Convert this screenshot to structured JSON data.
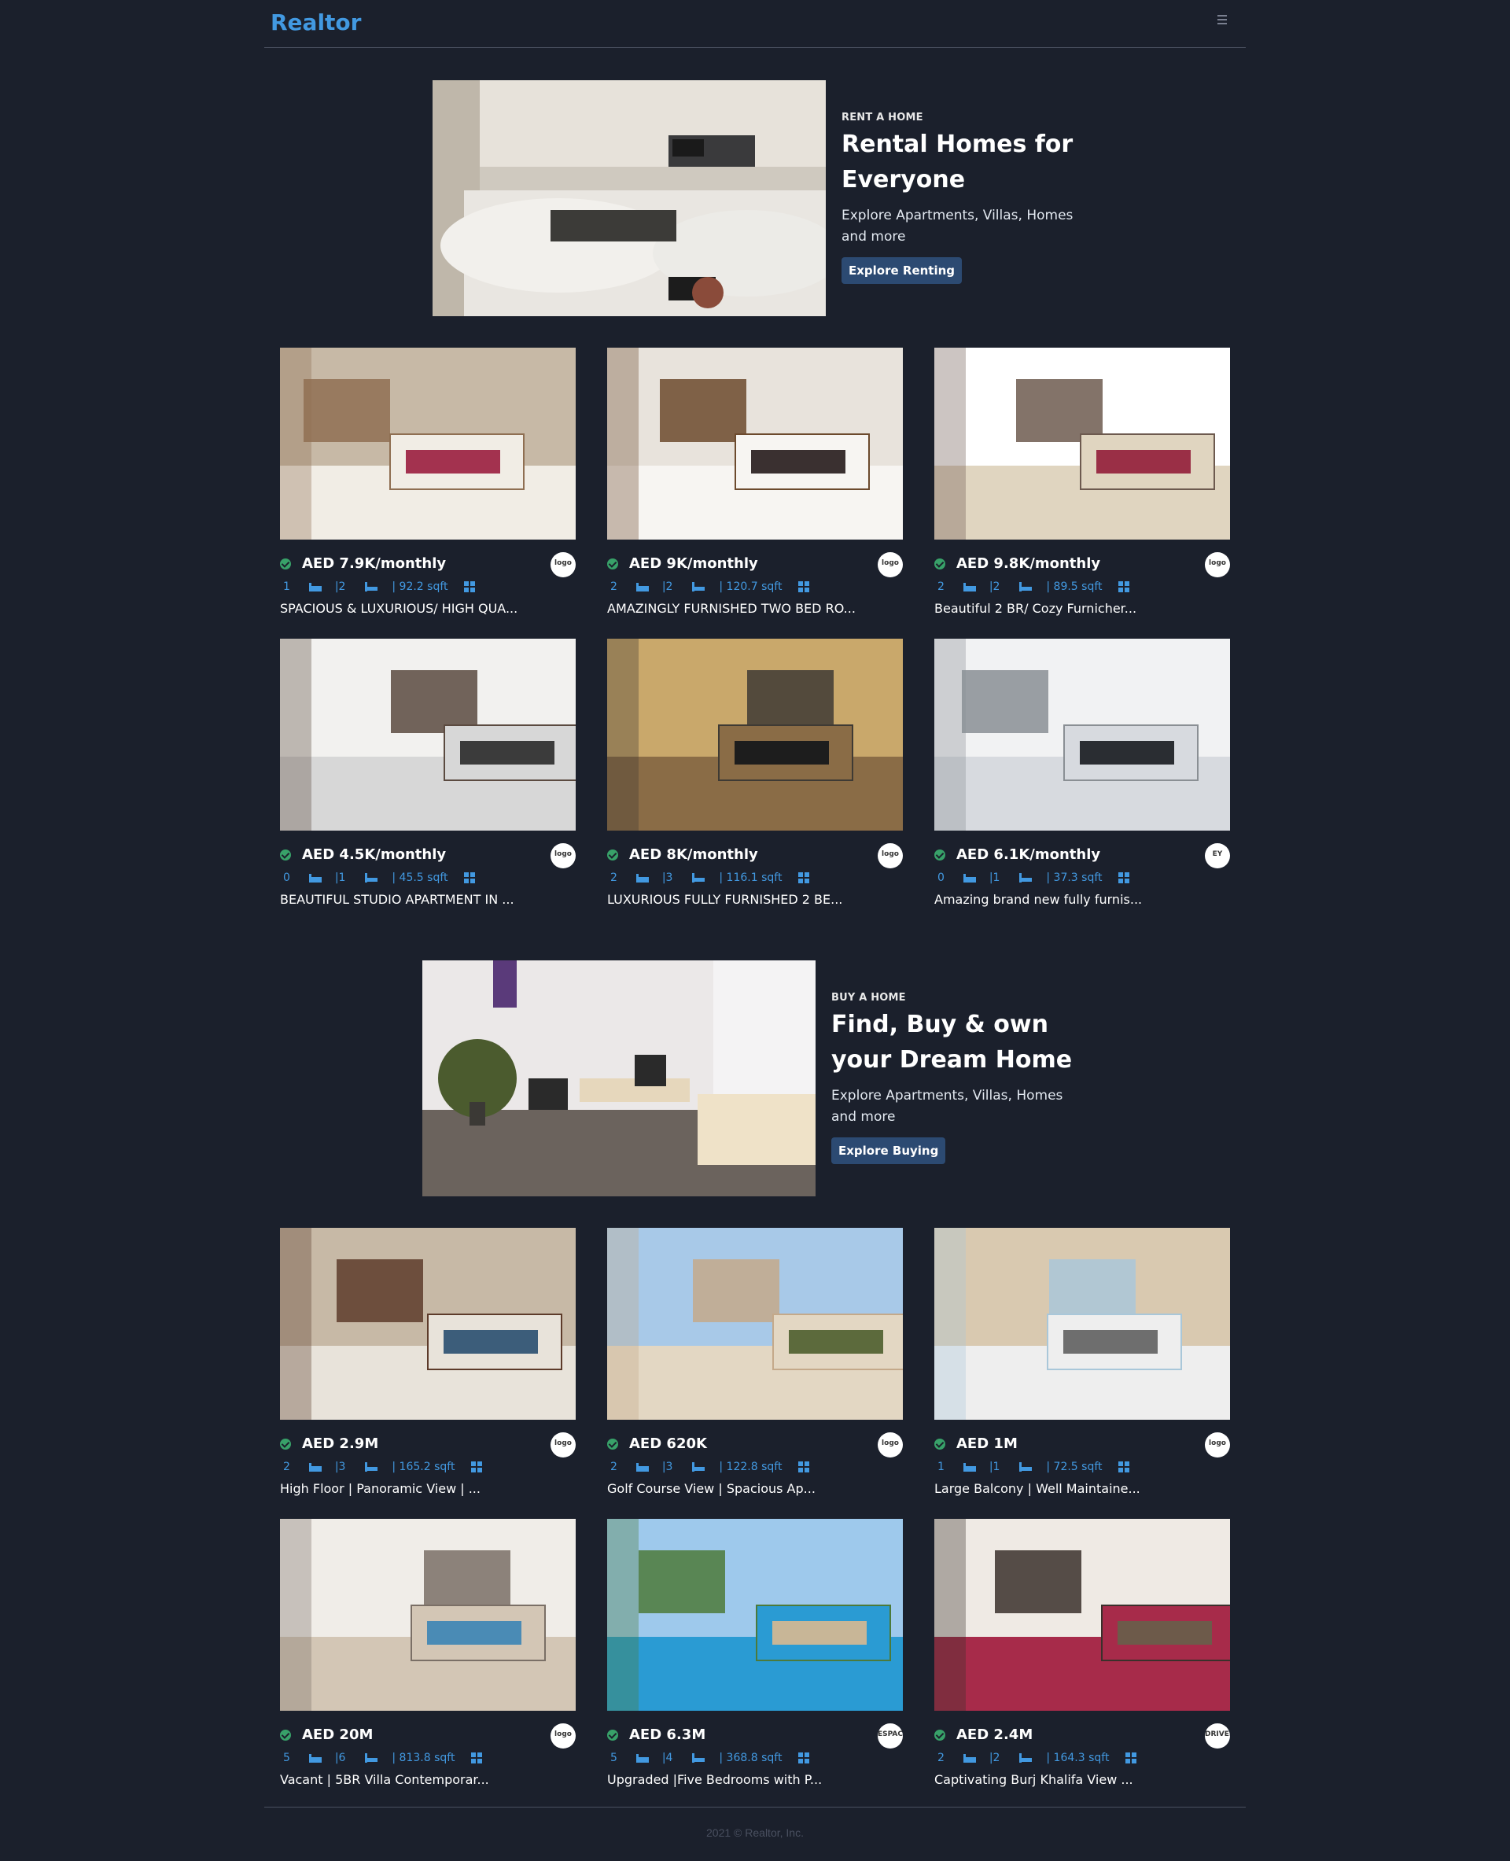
{
  "header": {
    "logo": "Realtor",
    "menu_icon": "hamburger-icon"
  },
  "rent_banner": {
    "purpose": "RENT A HOME",
    "title": "Rental Homes for Everyone",
    "description": "Explore Apartments, Villas, Homes and more",
    "button": "Explore Renting"
  },
  "rent_listings": [
    {
      "price": "AED 7.9K/monthly",
      "rooms": "1",
      "baths": "2",
      "area": "92.2 sqft",
      "title": "SPACIOUS & LUXURIOUS/ HIGH QUA...",
      "agency": "logo"
    },
    {
      "price": "AED 9K/monthly",
      "rooms": "2",
      "baths": "2",
      "area": "120.7 sqft",
      "title": "AMAZINGLY FURNISHED TWO BED RO...",
      "agency": "logo"
    },
    {
      "price": "AED 9.8K/monthly",
      "rooms": "2",
      "baths": "2",
      "area": "89.5 sqft",
      "title": "Beautiful 2 BR/ Cozy Furnicher...",
      "agency": "logo"
    },
    {
      "price": "AED 4.5K/monthly",
      "rooms": "0",
      "baths": "1",
      "area": "45.5 sqft",
      "title": "BEAUTIFUL STUDIO APARTMENT IN ...",
      "agency": "logo"
    },
    {
      "price": "AED 8K/monthly",
      "rooms": "2",
      "baths": "3",
      "area": "116.1 sqft",
      "title": "LUXURIOUS FULLY FURNISHED 2 BE...",
      "agency": "logo"
    },
    {
      "price": "AED 6.1K/monthly",
      "rooms": "0",
      "baths": "1",
      "area": "37.3 sqft",
      "title": "Amazing brand new fully furnis...",
      "agency": "EY"
    }
  ],
  "buy_banner": {
    "purpose": "BUY A HOME",
    "title": "Find, Buy & own your Dream Home",
    "description": "Explore Apartments, Villas, Homes and more",
    "button": "Explore Buying"
  },
  "buy_listings": [
    {
      "price": "AED 2.9M",
      "rooms": "2",
      "baths": "3",
      "area": "165.2 sqft",
      "title": "High Floor | Panoramic View | ...",
      "agency": "logo"
    },
    {
      "price": "AED 620K",
      "rooms": "2",
      "baths": "3",
      "area": "122.8 sqft",
      "title": "Golf Course View | Spacious Ap...",
      "agency": "logo"
    },
    {
      "price": "AED 1M",
      "rooms": "1",
      "baths": "1",
      "area": "72.5 sqft",
      "title": "Large Balcony | Well Maintaine...",
      "agency": "logo"
    },
    {
      "price": "AED 20M",
      "rooms": "5",
      "baths": "6",
      "area": "813.8 sqft",
      "title": "Vacant | 5BR Villa Contemporar...",
      "agency": "logo"
    },
    {
      "price": "AED 6.3M",
      "rooms": "5",
      "baths": "4",
      "area": "368.8 sqft",
      "title": "Upgraded |Five Bedrooms with P...",
      "agency": "ESPACE"
    },
    {
      "price": "AED 2.4M",
      "rooms": "2",
      "baths": "2",
      "area": "164.3 sqft",
      "title": "Captivating Burj Khalifa View ...",
      "agency": "DRIVEN"
    }
  ],
  "footer": {
    "text": "2021 © Realtor, Inc."
  },
  "colors": {
    "background": "#1b202c",
    "accent": "#4299e1",
    "button": "#2c4a72",
    "verified": "#38a169"
  }
}
